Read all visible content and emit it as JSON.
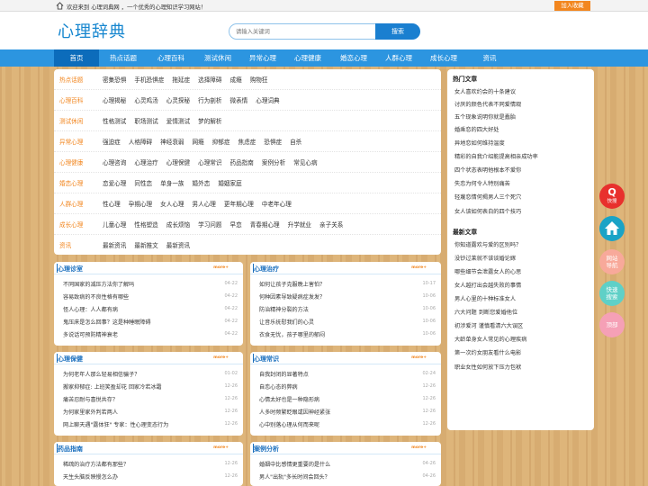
{
  "topbar": {
    "welcome": "欢迎来到 心理词典网 ，一个优秀的心理知识学习网站！",
    "favorite": "加入收藏"
  },
  "header": {
    "logo": "心理辞典",
    "search_placeholder": "请输入关键词",
    "search_button": "搜索"
  },
  "nav": [
    "首页",
    "热点话题",
    "心理百科",
    "测试休闲",
    "异常心理",
    "心理健康",
    "婚恋心理",
    "人群心理",
    "成长心理",
    "资讯"
  ],
  "categories": [
    {
      "label": "热点话题",
      "links": [
        "密集恐惧",
        "手机恐惧症",
        "拖延症",
        "选择障碍",
        "成瘾",
        "购物狂"
      ]
    },
    {
      "label": "心理百科",
      "links": [
        "心理揭秘",
        "心灵鸡汤",
        "心灵探秘",
        "行为剖析",
        "微表情",
        "心理词典"
      ]
    },
    {
      "label": "测试休闲",
      "links": [
        "性格测试",
        "职场测试",
        "爱情测试",
        "梦的解析"
      ]
    },
    {
      "label": "异常心理",
      "links": [
        "强迫症",
        "人格障碍",
        "神经衰弱",
        "网瘾",
        "抑郁症",
        "焦虑症",
        "恐惧症",
        "自杀"
      ]
    },
    {
      "label": "心理健康",
      "links": [
        "心理咨询",
        "心理治疗",
        "心理保健",
        "心理常识",
        "药品指南",
        "案例分析",
        "常见心病"
      ]
    },
    {
      "label": "婚恋心理",
      "links": [
        "恋爱心理",
        "同性恋",
        "单身一族",
        "婚外恋",
        "婚姻家庭"
      ]
    },
    {
      "label": "人群心理",
      "links": [
        "性心理",
        "孕期心理",
        "女人心理",
        "男人心理",
        "更年期心理",
        "中老年心理"
      ]
    },
    {
      "label": "成长心理",
      "links": [
        "儿童心理",
        "性格塑造",
        "成长烦恼",
        "学习问题",
        "早恋",
        "青春期心理",
        "升学就业",
        "亲子关系"
      ]
    },
    {
      "label": "资讯",
      "links": [
        "最新资讯",
        "最新推文",
        "最新资讯"
      ]
    }
  ],
  "more_label": "more+",
  "boxes": [
    {
      "title": "心理诊室",
      "items": [
        {
          "text": "不同国家的减压方法你了解吗",
          "date": "04-22"
        },
        {
          "text": "容易致病的不良性格有哪些",
          "date": "04-22"
        },
        {
          "text": "怪人心理：人人都有病",
          "date": "04-22"
        },
        {
          "text": "鬼压床是怎么回事？这是种睡眠障碍",
          "date": "04-22"
        },
        {
          "text": "多说话可预防精神衰老",
          "date": "04-22"
        }
      ]
    },
    {
      "title": "心理治疗",
      "items": [
        {
          "text": "如何让孩子克服晚上害怕？",
          "date": "10-17"
        },
        {
          "text": "何种因素导致疑病症发发？",
          "date": "10-06"
        },
        {
          "text": "防治精神分裂的方法",
          "date": "10-06"
        },
        {
          "text": "让音乐抚慰我们的心灵",
          "date": "10-06"
        },
        {
          "text": "衣食无忧，孩子哪里的郁闷",
          "date": "10-06"
        }
      ]
    },
    {
      "title": "心理保健",
      "items": [
        {
          "text": "为何老年人那么轻易相信骗子？",
          "date": "01-02"
        },
        {
          "text": "搬家抑郁症: 上班笑盈却花 回家冷若冰霜",
          "date": "12-26"
        },
        {
          "text": "痛苦忍耐与喜悦共存？",
          "date": "12-26"
        },
        {
          "text": "为何家里家外判若两人",
          "date": "12-26"
        },
        {
          "text": "网上聊天遇\"露体狂\" 专家：性心理变态行为",
          "date": "12-26"
        }
      ]
    },
    {
      "title": "心理常识",
      "items": [
        {
          "text": "自我封闭的显著特点",
          "date": "02-24"
        },
        {
          "text": "自恋心态的弊病",
          "date": "12-26"
        },
        {
          "text": "心情太好也是一种隐形病",
          "date": "12-26"
        },
        {
          "text": "人多时频繁眨眼或因神经紧张",
          "date": "12-26"
        },
        {
          "text": "心中别落心理从何而来呢",
          "date": "12-26"
        }
      ]
    },
    {
      "title": "药品指南",
      "items": [
        {
          "text": "稀疏的治疗方法都有那些？",
          "date": "12-26"
        },
        {
          "text": "天生头脑反映慢怎么办",
          "date": "12-26"
        }
      ]
    },
    {
      "title": "案例分析",
      "items": [
        {
          "text": "婚姻中比感情更重要的是什么",
          "date": "04-26"
        },
        {
          "text": "男人\"出轨\"多长时间会回头？",
          "date": "04-26"
        }
      ]
    }
  ],
  "sidebar": {
    "hot_title": "热门文章",
    "hot": [
      "女人喜欢约会的十条建议",
      "讨厌的颜色代表不同爱情观",
      "五个现象说明你就是蠢胎",
      "婚乘恋的四大好处",
      "异地恋如何维持温度",
      "精彩的自我介绍能提高相亲成功率",
      "四个状态表明他根本不爱你",
      "失恋为何令人特别痛苦",
      "轻蔑恋情何揭男人三个死穴",
      "女人该如何表白的四个技巧"
    ],
    "new_title": "最新文章",
    "new": [
      "你知道露欢与爱的区别吗？",
      "没钞过莱就不该谈婚论嫁",
      "哪些细节会泄露女人的心思",
      "女人越打出会越失败的事情",
      "男人心里的十种标准女人",
      "六大问题 到断您爱婚他位",
      "初涉爱河 谨慎看清六大误区",
      "大龄单身女人常见的心理疾病",
      "第一次约女朋友看什么电影",
      "职业女性如何放下压力包袱"
    ]
  },
  "floating": [
    {
      "icon": "Q",
      "label": "快搜",
      "color": "#e8302d"
    },
    {
      "label": "",
      "color": "#1aa3c6"
    },
    {
      "label": "网站\n导航",
      "color": "#f8a99a"
    },
    {
      "label": "快速\n搜索",
      "color": "#5fd0c7"
    },
    {
      "label": "顶部",
      "color": "#f5a0b6"
    }
  ]
}
